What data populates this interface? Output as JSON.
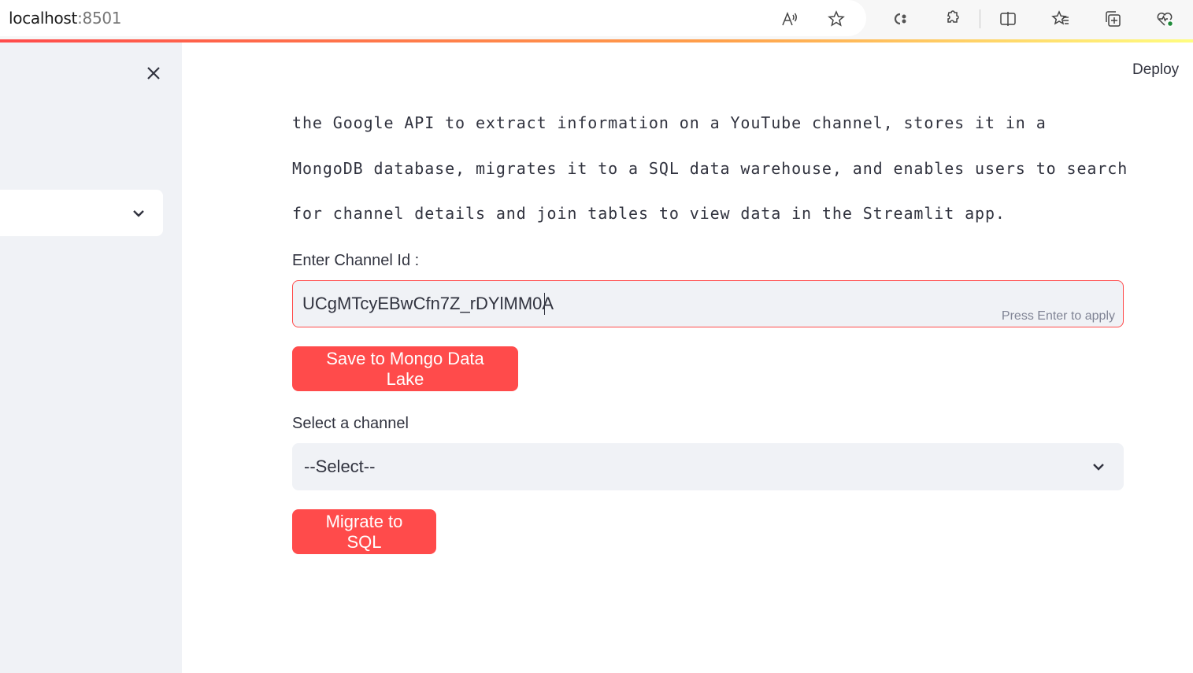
{
  "browser": {
    "url_host": "localhost",
    "url_port": ":8501",
    "toolbar_icons": [
      "read-aloud-icon",
      "favorite-star-icon",
      "copilot-icon",
      "extensions-icon",
      "split-screen-icon",
      "favorites-icon",
      "collections-icon",
      "browser-essentials-icon"
    ]
  },
  "header": {
    "deploy_label": "Deploy"
  },
  "sidebar": {
    "select_value": ""
  },
  "main": {
    "description_lines": [
      "the Google API to extract information on a YouTube channel, stores it in a",
      "MongoDB database, migrates it to a SQL data warehouse, and enables users to search",
      "for channel details and join tables to view data in the Streamlit app."
    ],
    "channel_id": {
      "label": "Enter Channel Id :",
      "value": "UCgMTcyEBwCfn7Z_rDYlMM0A",
      "hint": "Press Enter to apply"
    },
    "save_button_label": "Save to Mongo Data Lake",
    "channel_select": {
      "label": "Select a channel",
      "value": "--Select--"
    },
    "migrate_button_label": "Migrate to SQL"
  },
  "colors": {
    "primary": "#ff4b4b",
    "sidebar_bg": "#f0f2f6",
    "text": "#31333f"
  }
}
